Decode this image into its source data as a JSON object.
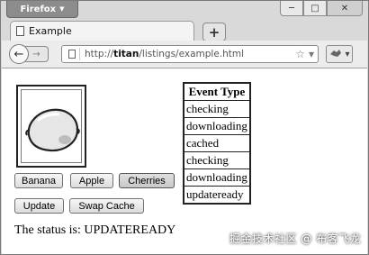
{
  "browser": {
    "menu_label": "Firefox",
    "menu_arrow": "▼",
    "window_controls": {
      "minimize": "─",
      "maximize": "□",
      "close": "✕"
    },
    "tab_title": "Example",
    "new_tab_label": "+",
    "back_arrow": "←",
    "forward_arrow": "→",
    "url_prefix": "http://",
    "url_host": "titan",
    "url_path": "/listings/example.html",
    "star_icon": "☆",
    "dropdown_arrow": "▾",
    "addon_icon": "puzzle-icon"
  },
  "page": {
    "image_icon": "lemon-image",
    "buttons": {
      "banana": "Banana",
      "apple": "Apple",
      "cherries": "Cherries",
      "update": "Update",
      "swap_cache": "Swap Cache"
    },
    "status_prefix": "The status is: ",
    "status_value": "UPDATEREADY",
    "events_header": "Event Type",
    "events": [
      "checking",
      "downloading",
      "cached",
      "checking",
      "downloading",
      "updateready"
    ]
  },
  "watermark": "掘金技术社区 @ 布客飞龙"
}
